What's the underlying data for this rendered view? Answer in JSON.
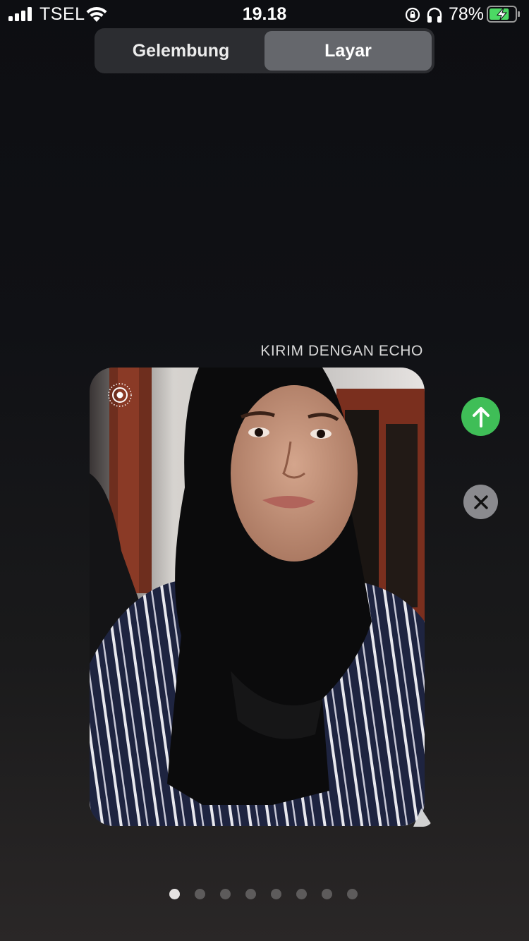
{
  "status_bar": {
    "carrier": "TSEL",
    "time": "19.18",
    "battery_percent": "78%",
    "battery_level": 0.78,
    "icons": [
      "signal-icon",
      "wifi-icon",
      "rotation-lock-icon",
      "headphones-icon",
      "battery-charging-icon"
    ]
  },
  "segmented": {
    "items": [
      {
        "label": "Gelembung",
        "active": false
      },
      {
        "label": "Layar",
        "active": true
      }
    ]
  },
  "effect": {
    "label": "KIRIM DENGAN ECHO"
  },
  "preview": {
    "live_photo_icon": "live-photo-icon"
  },
  "actions": {
    "send_icon": "arrow-up-icon",
    "cancel_icon": "close-icon",
    "send_color": "#3fbe57",
    "cancel_color": "#8a8a8e"
  },
  "pager": {
    "count": 8,
    "active_index": 0
  }
}
